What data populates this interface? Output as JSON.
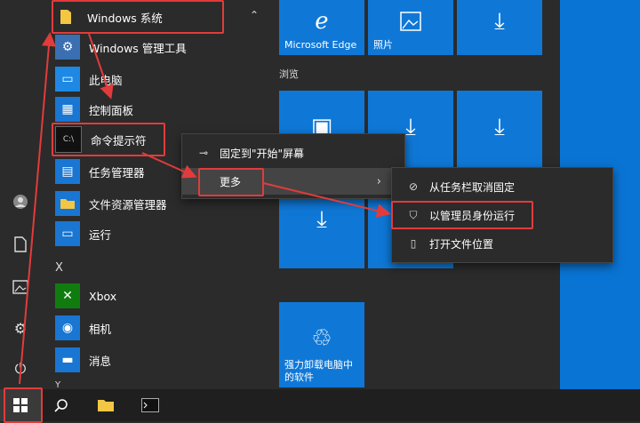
{
  "colors": {
    "tile_blue": "#0f78d7",
    "desktop_blue": "#0a74d4",
    "highlight_red": "#e23b3b"
  },
  "app_list": {
    "group_windows_system": "Windows 系统",
    "items": [
      {
        "label": "Windows 管理工具",
        "icon": "admin-tools-icon"
      },
      {
        "label": "此电脑",
        "icon": "computer-icon"
      },
      {
        "label": "控制面板",
        "icon": "control-panel-icon"
      },
      {
        "label": "命令提示符",
        "icon": "cmd-icon"
      },
      {
        "label": "任务管理器",
        "icon": "task-manager-icon"
      },
      {
        "label": "文件资源管理器",
        "icon": "folder-icon"
      },
      {
        "label": "运行",
        "icon": "run-icon"
      }
    ],
    "section_x": "X",
    "items_x": [
      {
        "label": "Xbox",
        "icon": "xbox-icon"
      },
      {
        "label": "相机",
        "icon": "camera-icon"
      },
      {
        "label": "消息",
        "icon": "message-icon"
      }
    ],
    "section_y": "Y"
  },
  "tiles": {
    "edge": "Microsoft Edge",
    "photos": "照片",
    "browse_header": "浏览",
    "uninstall": "强力卸载电脑中的软件"
  },
  "context_menu": {
    "pin_start": "固定到\"开始\"屏幕",
    "more": "更多"
  },
  "submenu": {
    "unpin_taskbar": "从任务栏取消固定",
    "run_as_admin": "以管理员身份运行",
    "open_location": "打开文件位置"
  }
}
